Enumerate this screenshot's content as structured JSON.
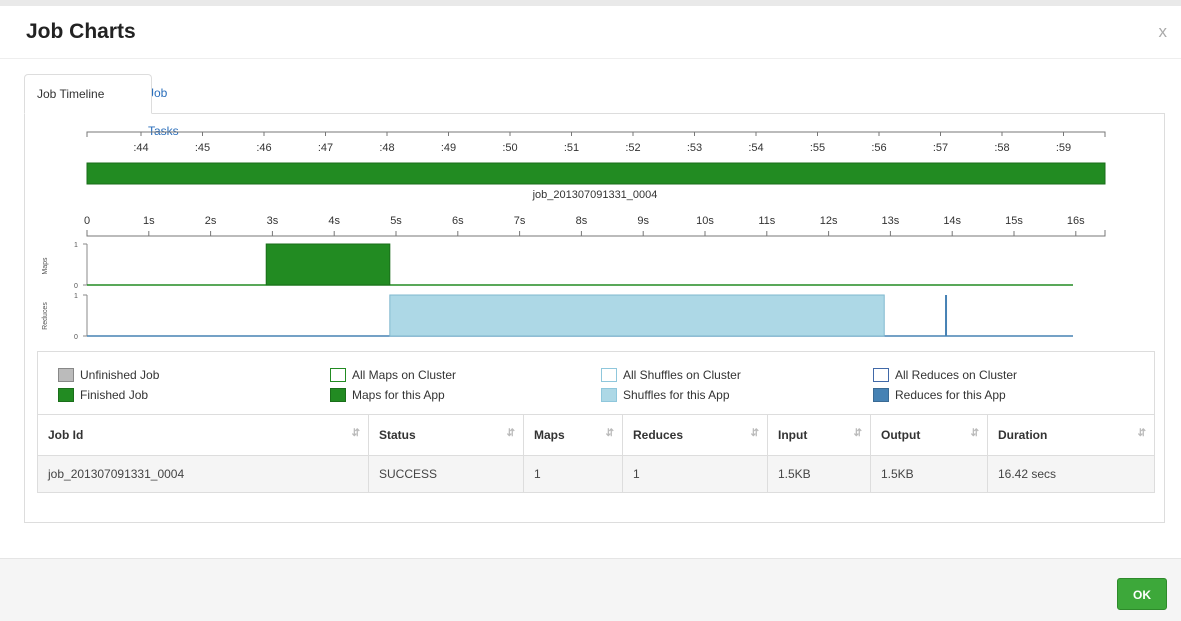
{
  "modal": {
    "title": "Job Charts",
    "close_label": "x",
    "ok_label": "OK"
  },
  "tabs": [
    {
      "label": "Job Timeline",
      "active": true
    },
    {
      "label": "Job Tasks",
      "active": false
    }
  ],
  "timeline": {
    "clock_ticks": [
      ":44",
      ":45",
      ":46",
      ":47",
      ":48",
      ":49",
      ":50",
      ":51",
      ":52",
      ":53",
      ":54",
      ":55",
      ":56",
      ":57",
      ":58",
      ":59"
    ],
    "job_label": "job_201307091331_0004",
    "elapsed_ticks": [
      "0",
      "1s",
      "2s",
      "3s",
      "4s",
      "5s",
      "6s",
      "7s",
      "8s",
      "9s",
      "10s",
      "11s",
      "12s",
      "13s",
      "14s",
      "15s",
      "16s"
    ],
    "job_bar_color": "#228b22",
    "maps_track": {
      "label": "Maps",
      "ymin": "0",
      "ymax": "1",
      "start_s": 2.9,
      "end_s": 4.9,
      "value": 1,
      "color": "#228b22"
    },
    "reduces_track": {
      "label": "Reduces",
      "ymin": "0",
      "ymax": "1",
      "shuffle_start_s": 4.9,
      "shuffle_end_s": 12.9,
      "reduce_spike_s": 13.9,
      "value": 1,
      "shuffle_color": "#add8e6",
      "reduce_color": "#4682b4"
    }
  },
  "legend": [
    {
      "label": "Unfinished Job",
      "fill": "#bbbbbb",
      "border": "#888888"
    },
    {
      "label": "Finished Job",
      "fill": "#228b22",
      "border": "#1a6e1a"
    },
    {
      "label": "All Maps on Cluster",
      "fill": "#ffffff",
      "border": "#228b22"
    },
    {
      "label": "Maps for this App",
      "fill": "#228b22",
      "border": "#1a6e1a"
    },
    {
      "label": "All Shuffles on Cluster",
      "fill": "#ffffff",
      "border": "#8fc7dc"
    },
    {
      "label": "Shuffles for this App",
      "fill": "#add8e6",
      "border": "#8fc7dc"
    },
    {
      "label": "All Reduces on Cluster",
      "fill": "#ffffff",
      "border": "#4169a8"
    },
    {
      "label": "Reduces for this App",
      "fill": "#4682b4",
      "border": "#3a6a94"
    }
  ],
  "table": {
    "headers": [
      "Job Id",
      "Status",
      "Maps",
      "Reduces",
      "Input",
      "Output",
      "Duration"
    ],
    "rows": [
      [
        "job_201307091331_0004",
        "SUCCESS",
        "1",
        "1",
        "1.5KB",
        "1.5KB",
        "16.42 secs"
      ]
    ]
  }
}
